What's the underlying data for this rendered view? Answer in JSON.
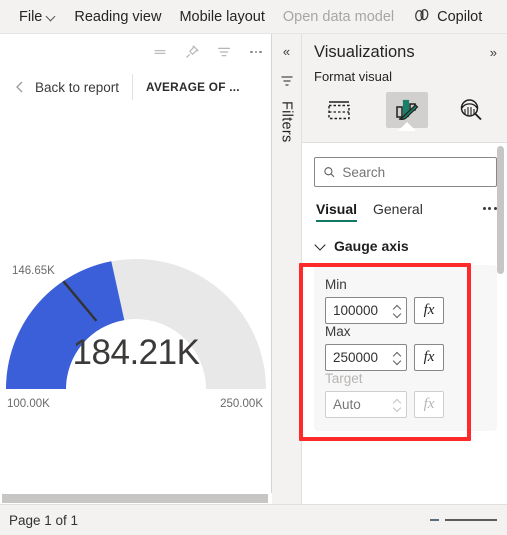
{
  "menubar": {
    "items": [
      {
        "label": "File",
        "icon": "chevron-down-icon",
        "dim": false
      },
      {
        "label": "Reading view",
        "dim": false
      },
      {
        "label": "Mobile layout",
        "dim": false
      },
      {
        "label": "Open data model",
        "dim": true
      },
      {
        "label": "Copilot",
        "icon": "copilot-icon",
        "dim": false
      }
    ]
  },
  "visual_toolbar": {
    "icons": [
      "collapse-icon",
      "pin-icon",
      "filter-icon",
      "more-options-icon"
    ]
  },
  "report_header": {
    "back_icon": "chevron-left-icon",
    "back_label": "Back to report",
    "visual_title": "AVERAGE OF ..."
  },
  "gauge": {
    "target_label": "146.65K",
    "min_label": "100.00K",
    "max_label": "250.00K",
    "value_label": "184.21K",
    "fill_color": "#3a5fd9",
    "track_color": "#e8e8e8",
    "target_marker_color": "#333333"
  },
  "chart_data": {
    "type": "gauge",
    "title": "AVERAGE OF ...",
    "value": 184210,
    "value_label": "184.21K",
    "min": 100000,
    "max": 250000,
    "min_label": "100.00K",
    "max_label": "250.00K",
    "target": 146650,
    "target_label": "146.65K",
    "fill_color": "#3a5fd9",
    "track_color": "#e8e8e8",
    "percent_filled": 56.1
  },
  "filters_rail": {
    "collapse_icon": "chevron-double-left-icon",
    "filter_icon": "filter-bars-icon",
    "label": "Filters"
  },
  "visualizations": {
    "title": "Visualizations",
    "expand_icon": "chevron-double-right-icon",
    "subtitle": "Format visual",
    "icon_buttons": [
      {
        "name": "build-visual-icon",
        "selected": false
      },
      {
        "name": "format-visual-icon",
        "selected": true
      },
      {
        "name": "analytics-icon",
        "selected": false
      }
    ],
    "search": {
      "placeholder": "Search",
      "value": "",
      "icon": "search-icon"
    },
    "tabs": [
      {
        "label": "Visual",
        "active": true
      },
      {
        "label": "General",
        "active": false
      }
    ],
    "tabs_more_icon": "more-options-icon",
    "section": {
      "title": "Gauge axis",
      "expanded": true,
      "chevron_icon": "chevron-down-icon",
      "fields": [
        {
          "label": "Min",
          "value": "100000",
          "placeholder": "",
          "fx_label": "fx",
          "disabled": false
        },
        {
          "label": "Max",
          "value": "250000",
          "placeholder": "",
          "fx_label": "fx",
          "disabled": false
        },
        {
          "label": "Target",
          "value": "",
          "placeholder": "Auto",
          "fx_label": "fx",
          "disabled": true
        }
      ]
    }
  },
  "annotation": {
    "color": "#fc2a2a"
  },
  "statusbar": {
    "page_label": "Page 1 of 1",
    "zoom_minus": "-"
  }
}
